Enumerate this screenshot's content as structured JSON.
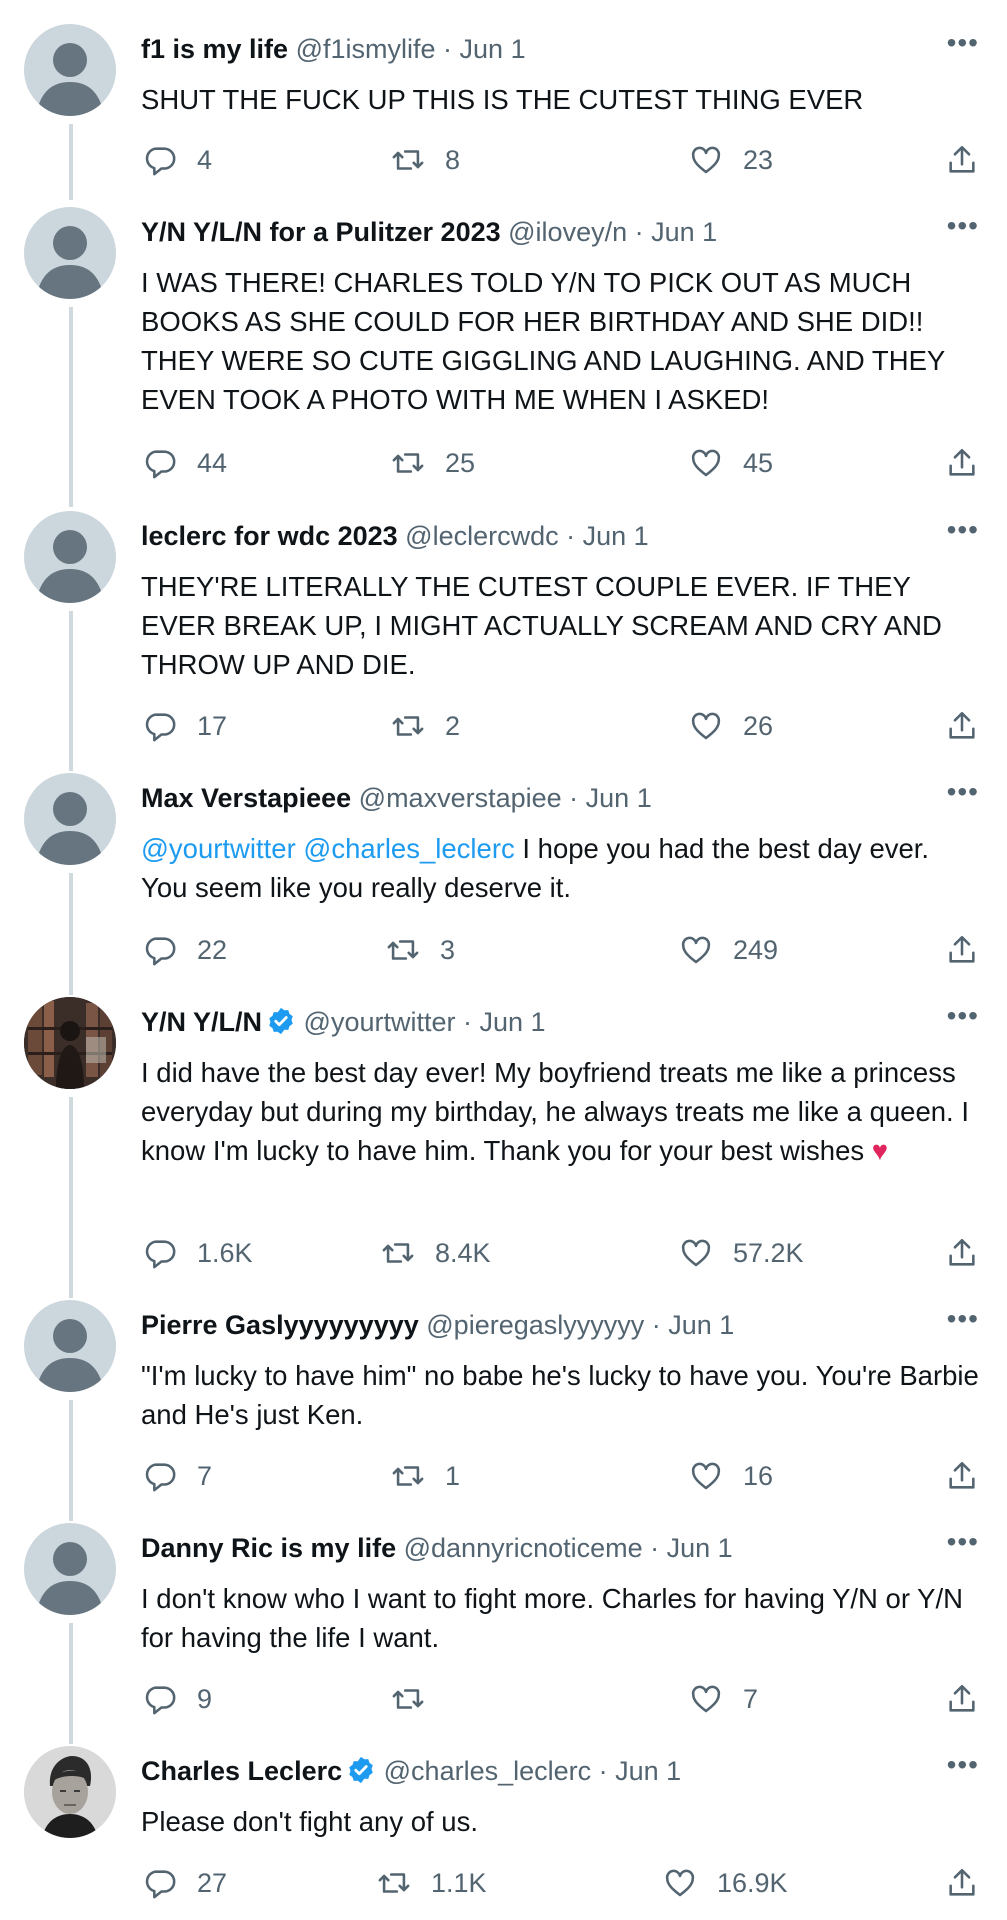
{
  "colors": {
    "text": "#0f1419",
    "muted": "#536471",
    "link": "#1d9bf0",
    "verified": "#1d9bf0",
    "thread_line": "#cfd9de",
    "heart": "#e0245e"
  },
  "tweets": [
    {
      "name": "f1 is my life",
      "handle": "@f1ismylife",
      "date": "· Jun 1",
      "text": "SHUT THE FUCK UP THIS IS THE CUTEST THING EVER",
      "replies": "4",
      "retweets": "8",
      "likes": "23"
    },
    {
      "name": "Y/N Y/L/N for a Pulitzer 2023",
      "handle": "@ilovey/n",
      "date": "· Jun 1",
      "text": "I WAS THERE! CHARLES TOLD Y/N TO PICK OUT AS MUCH BOOKS AS SHE COULD FOR HER BIRTHDAY AND SHE DID!! THEY WERE SO CUTE GIGGLING AND LAUGHING. AND THEY EVEN TOOK A PHOTO WITH ME WHEN I ASKED!",
      "replies": "44",
      "retweets": "25",
      "likes": "45"
    },
    {
      "name": "leclerc for wdc 2023",
      "handle": "@leclercwdc",
      "date": "· Jun 1",
      "text": "THEY'RE LITERALLY THE CUTEST COUPLE EVER. IF THEY EVER BREAK UP, I MIGHT ACTUALLY SCREAM AND CRY AND THROW UP AND DIE.",
      "replies": "17",
      "retweets": "2",
      "likes": "26"
    },
    {
      "name": "Max Verstapieee",
      "handle": "@maxverstapiee",
      "date": "· Jun 1",
      "mention1": "@yourtwitter",
      "mention2": "@charles_leclerc",
      "text": "I hope you had the best day ever. You seem like you really deserve it.",
      "replies": "22",
      "retweets": "3",
      "likes": "249"
    },
    {
      "name": "Y/N Y/L/N",
      "handle": "@yourtwitter",
      "date": "· Jun 1",
      "verified": true,
      "text": "I did have the best day ever! My boyfriend treats me like a princess everyday but during my birthday, he always treats me like a queen. I know I'm lucky to have him. Thank you for your best wishes",
      "emoji": "♥",
      "replies": "1.6K",
      "retweets": "8.4K",
      "likes": "57.2K"
    },
    {
      "name": "Pierre Gaslyyyyyyyyy",
      "handle": "@pieregaslyyyyyy",
      "date": "· Jun 1",
      "text": "\"I'm lucky to have him\" no babe he's lucky to have you. You're Barbie and He's just Ken.",
      "replies": "7",
      "retweets": "1",
      "likes": "16"
    },
    {
      "name": "Danny Ric is my life",
      "handle": "@dannyricnoticeme",
      "date": "· Jun 1",
      "text": "I don't know who I want to fight more. Charles for having Y/N or Y/N for having the life I want.",
      "replies": "9",
      "retweets": "",
      "likes": "7"
    },
    {
      "name": "Charles Leclerc",
      "handle": "@charles_leclerc",
      "date": "· Jun 1",
      "verified": true,
      "text": "Please don't fight any of us.",
      "replies": "27",
      "retweets": "1.1K",
      "likes": "16.9K"
    }
  ],
  "icons": {
    "more": "more-icon",
    "reply": "reply-icon",
    "retweet": "retweet-icon",
    "like": "like-icon",
    "share": "share-icon",
    "verified": "verified-icon"
  },
  "more_label": "•••"
}
